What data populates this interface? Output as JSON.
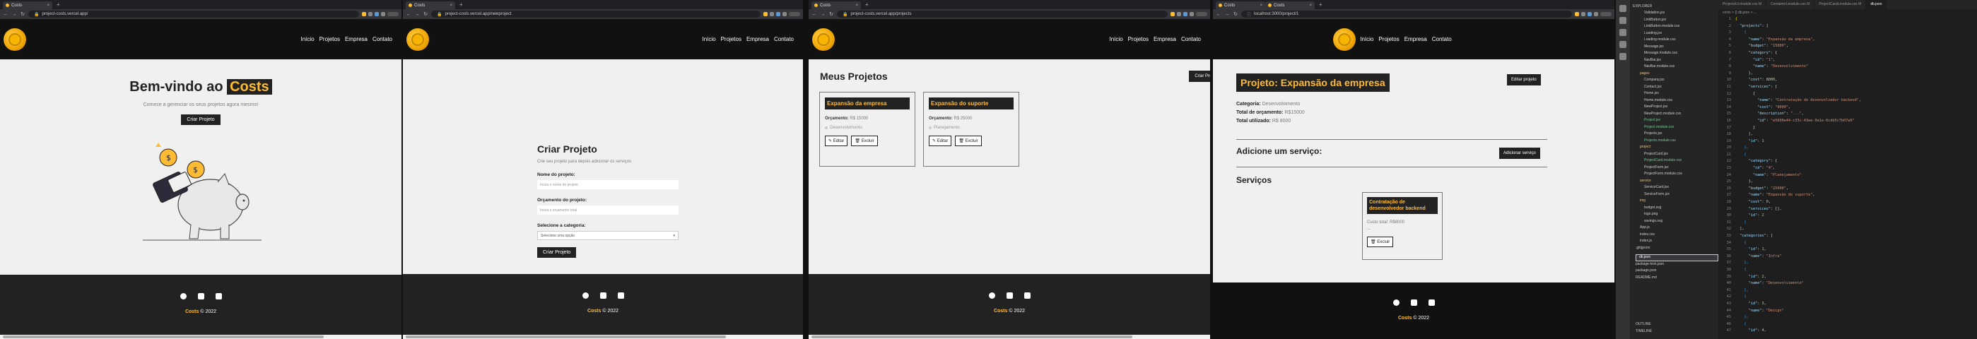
{
  "browser": {
    "win1": {
      "tab_title": "Costs",
      "url": "project-costs.vercel.app/"
    },
    "win2": {
      "tab_title": "Costs",
      "url": "project-costs.vercel.app/newproject"
    },
    "win3": {
      "tab_title": "Costs",
      "url": "project-costs.vercel.app/projects"
    },
    "win4": {
      "tab_title": "Costs",
      "url": "localhost:3000/project/1"
    }
  },
  "nav": {
    "items": [
      "Início",
      "Projetos",
      "Empresa",
      "Contato"
    ]
  },
  "home": {
    "title_prefix": "Bem-vindo ao",
    "title_highlight": "Costs",
    "subtitle": "Comece a gerenciar os seus projetos agora mesmo!",
    "cta": "Criar Projeto"
  },
  "footer": {
    "brand": "Costs",
    "copyright": "© 2022"
  },
  "new_project": {
    "title": "Criar Projeto",
    "subtitle": "Crie seu projeto para depois adicionar os serviços",
    "name_label": "Nome do projeto:",
    "name_placeholder": "Insira o nome do projeto",
    "budget_label": "Orçamento do projeto:",
    "budget_placeholder": "Insira o orçamento total",
    "category_label": "Selecione a categoria:",
    "category_value": "Selecione uma opção",
    "submit": "Criar Projeto"
  },
  "projects": {
    "title": "Meus Projetos",
    "new_button": "Criar Projeto",
    "budget_label": "Orçamento:",
    "edit": "Editar",
    "remove": "Excluir",
    "cards": [
      {
        "name": "Expansão da empresa",
        "budget": "R$ 15000",
        "category": "Desenvolvimento"
      },
      {
        "name": "Expansão do suporte",
        "budget": "R$ 25000",
        "category": "Planejamento"
      }
    ]
  },
  "project_detail": {
    "title": "Projeto: Expansão da empresa",
    "edit_button": "Editar projeto",
    "category_label": "Categoria:",
    "category_value": "Desenvolvimento",
    "budget_label": "Total de orçamento:",
    "budget_value": "R$15000",
    "used_label": "Total utilizado:",
    "used_value": "R$ 8000",
    "add_service_title": "Adicione um serviço:",
    "add_service_button": "Adicionar serviço",
    "services_title": "Serviços",
    "service_card": {
      "name": "Contratação de desenvolvedor backend",
      "cost_label": "Custo total:",
      "cost_value": "R$8000",
      "desc": "...",
      "remove": "Excluir"
    }
  },
  "vscode": {
    "tabs": [
      "ProjectsUi.module.css M",
      "ContainerLmodule.css M",
      "ProjectCardLmodule.css M",
      "db.json"
    ],
    "active_tab": "db.json",
    "breadcrumb": "costs > {} db.json > ...",
    "explorer_header": "EXPLORER",
    "outline": "OUTLINE",
    "timeline": "TIMELINE",
    "files": [
      {
        "name": "Validation.jsx",
        "cls": "i2"
      },
      {
        "name": "LinkButton.jsx",
        "cls": "i2"
      },
      {
        "name": "LinkButton.module.css",
        "cls": "i2"
      },
      {
        "name": "Loading.jsx",
        "cls": "i2"
      },
      {
        "name": "Loading.module.css",
        "cls": "i2"
      },
      {
        "name": "Message.jsx",
        "cls": "i2"
      },
      {
        "name": "Message.module.css",
        "cls": "i2"
      },
      {
        "name": "NavBar.jsx",
        "cls": "i2"
      },
      {
        "name": "NavBar.module.css",
        "cls": "i2"
      },
      {
        "name": "pages",
        "cls": "i1 y"
      },
      {
        "name": "Company.jsx",
        "cls": "i2"
      },
      {
        "name": "Contact.jsx",
        "cls": "i2"
      },
      {
        "name": "Home.jsx",
        "cls": "i2"
      },
      {
        "name": "Home.module.css",
        "cls": "i2"
      },
      {
        "name": "NewProject.jsx",
        "cls": "i2"
      },
      {
        "name": "NewProject.module.css",
        "cls": "i2"
      },
      {
        "name": "Project.jsx",
        "cls": "i2 g"
      },
      {
        "name": "Project.module.css",
        "cls": "i2 g"
      },
      {
        "name": "Projects.jsx",
        "cls": "i2"
      },
      {
        "name": "Projects.module.css",
        "cls": "i2 g"
      },
      {
        "name": "project",
        "cls": "i1 y"
      },
      {
        "name": "ProjectCard.jsx",
        "cls": "i2"
      },
      {
        "name": "ProjectCard.module.css",
        "cls": "i2 g"
      },
      {
        "name": "ProjectForm.jsx",
        "cls": "i2"
      },
      {
        "name": "ProjectForm.module.css",
        "cls": "i2"
      },
      {
        "name": "service",
        "cls": "i1 y"
      },
      {
        "name": "ServiceCard.jsx",
        "cls": "i2"
      },
      {
        "name": "ServiceForm.jsx",
        "cls": "i2"
      },
      {
        "name": "img",
        "cls": "i1 y"
      },
      {
        "name": "budget.svg",
        "cls": "i2"
      },
      {
        "name": "logo.png",
        "cls": "i2"
      },
      {
        "name": "savings.svg",
        "cls": "i2"
      },
      {
        "name": "App.js",
        "cls": "i1"
      },
      {
        "name": "index.css",
        "cls": "i1"
      },
      {
        "name": "index.js",
        "cls": "i1"
      },
      {
        "name": ".gitignore",
        "cls": ""
      },
      {
        "name": "db.json",
        "cls": "sel"
      },
      {
        "name": "package-lock.json",
        "cls": ""
      },
      {
        "name": "package.json",
        "cls": ""
      },
      {
        "name": "README.md",
        "cls": ""
      }
    ],
    "code": [
      {
        "n": "1",
        "t": "{",
        "c": "br1"
      },
      {
        "n": "2",
        "t": "  \"projects\": [",
        "c": ""
      },
      {
        "n": "3",
        "t": "    {",
        "c": "br3"
      },
      {
        "n": "4",
        "t": "      \"name\": \"Expansão da empresa\",",
        "c": ""
      },
      {
        "n": "5",
        "t": "      \"budget\": \"15000\",",
        "c": ""
      },
      {
        "n": "6",
        "t": "      \"category\": {",
        "c": ""
      },
      {
        "n": "7",
        "t": "        \"id\": \"1\",",
        "c": ""
      },
      {
        "n": "8",
        "t": "        \"name\": \"Desenvolvimento\"",
        "c": ""
      },
      {
        "n": "9",
        "t": "      },",
        "c": ""
      },
      {
        "n": "10",
        "t": "      \"cost\": 8000,",
        "c": ""
      },
      {
        "n": "11",
        "t": "      \"services\": [",
        "c": ""
      },
      {
        "n": "12",
        "t": "        {",
        "c": ""
      },
      {
        "n": "13",
        "t": "          \"name\": \"Contratação de desenvolvedor backend\",",
        "c": ""
      },
      {
        "n": "14",
        "t": "          \"cost\": \"8000\",",
        "c": ""
      },
      {
        "n": "15",
        "t": "          \"description\": \"...\",",
        "c": ""
      },
      {
        "n": "16",
        "t": "          \"id\": \"e5600e44-c33c-43ee-9a1e-0cdb5c7b07e0\"",
        "c": ""
      },
      {
        "n": "17",
        "t": "        }",
        "c": ""
      },
      {
        "n": "18",
        "t": "      ],",
        "c": ""
      },
      {
        "n": "19",
        "t": "      \"id\": 1",
        "c": ""
      },
      {
        "n": "20",
        "t": "    },",
        "c": "br3"
      },
      {
        "n": "21",
        "t": "    {",
        "c": "br3"
      },
      {
        "n": "22",
        "t": "      \"category\": {",
        "c": ""
      },
      {
        "n": "23",
        "t": "        \"id\": \"4\",",
        "c": ""
      },
      {
        "n": "24",
        "t": "        \"name\": \"Planejamento\"",
        "c": ""
      },
      {
        "n": "25",
        "t": "      },",
        "c": ""
      },
      {
        "n": "26",
        "t": "      \"budget\": \"25000\",",
        "c": ""
      },
      {
        "n": "27",
        "t": "      \"name\": \"Expansão do suporte\",",
        "c": ""
      },
      {
        "n": "28",
        "t": "      \"cost\": 0,",
        "c": ""
      },
      {
        "n": "29",
        "t": "      \"services\": [],",
        "c": ""
      },
      {
        "n": "30",
        "t": "      \"id\": 2",
        "c": ""
      },
      {
        "n": "31",
        "t": "    }",
        "c": "br3"
      },
      {
        "n": "32",
        "t": "  ],",
        "c": ""
      },
      {
        "n": "33",
        "t": "  \"categories\": [",
        "c": ""
      },
      {
        "n": "34",
        "t": "    {",
        "c": "br3"
      },
      {
        "n": "35",
        "t": "      \"id\": 1,",
        "c": ""
      },
      {
        "n": "36",
        "t": "      \"name\": \"Infra\"",
        "c": ""
      },
      {
        "n": "37",
        "t": "    },",
        "c": "br3"
      },
      {
        "n": "38",
        "t": "    {",
        "c": "br3"
      },
      {
        "n": "39",
        "t": "      \"id\": 2,",
        "c": ""
      },
      {
        "n": "40",
        "t": "      \"name\": \"Desenvolvimento\"",
        "c": ""
      },
      {
        "n": "41",
        "t": "    },",
        "c": "br3"
      },
      {
        "n": "42",
        "t": "    {",
        "c": "br3"
      },
      {
        "n": "43",
        "t": "      \"id\": 3,",
        "c": ""
      },
      {
        "n": "44",
        "t": "      \"name\": \"Design\"",
        "c": ""
      },
      {
        "n": "45",
        "t": "    },",
        "c": "br3"
      },
      {
        "n": "46",
        "t": "    {",
        "c": "br3"
      },
      {
        "n": "47",
        "t": "      \"id\": 4,",
        "c": ""
      }
    ]
  }
}
